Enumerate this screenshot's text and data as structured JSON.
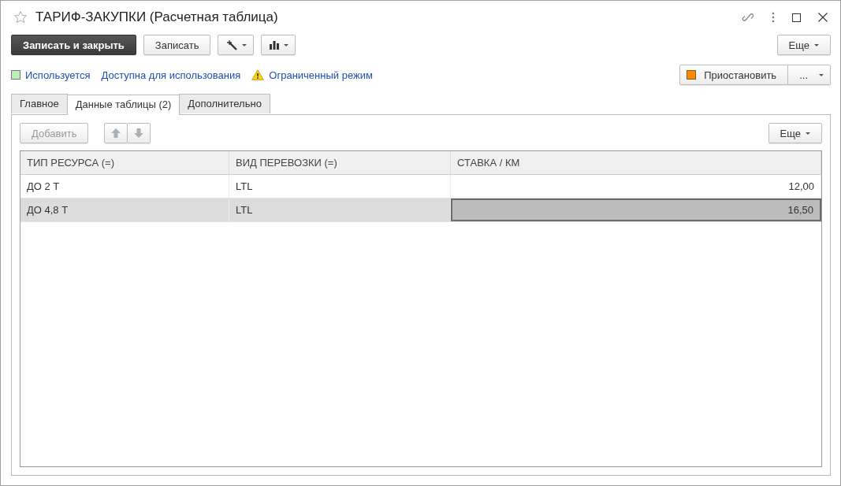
{
  "window": {
    "title": "ТАРИФ-ЗАКУПКИ (Расчетная таблица)",
    "favorite": false
  },
  "toolbar": {
    "buttons": [
      {
        "kind": "primary",
        "label": "Записать и закрыть"
      },
      {
        "kind": "normal",
        "label": "Записать"
      },
      {
        "kind": "wand-menu"
      },
      {
        "kind": "chart-menu"
      }
    ],
    "more": "Еще"
  },
  "status_links": [
    {
      "kind": "indicator",
      "label": "Используется"
    },
    {
      "kind": "plain",
      "label": "Доступна для использования"
    },
    {
      "kind": "warning",
      "label": "Ограниченный режим"
    }
  ],
  "suspend": {
    "label": "Приостановить",
    "more": "..."
  },
  "tabs": [
    {
      "label": "Главное",
      "selected": false
    },
    {
      "label": "Данные таблицы (2)",
      "selected": true
    },
    {
      "label": "Дополнительно",
      "selected": false
    }
  ],
  "table_toolbar": {
    "add": {
      "label": "Добавить",
      "disabled": true
    },
    "move_disabled": true,
    "more": "Еще"
  },
  "table": {
    "columns": [
      {
        "label": "ТИП РЕСУРСА (=)"
      },
      {
        "label": "ВИД ПЕРЕВОЗКИ (=)"
      },
      {
        "label": "СТАВКА / КМ"
      }
    ],
    "rows": [
      {
        "selected": false,
        "cells": [
          {
            "text": "ДО 2 Т",
            "focused": false
          },
          {
            "text": "LTL",
            "focused": false
          },
          {
            "text": "12,00",
            "focused": false
          }
        ]
      },
      {
        "selected": true,
        "cells": [
          {
            "text": "ДО 4,8 Т",
            "focused": false
          },
          {
            "text": "LTL",
            "focused": false
          },
          {
            "text": "16,50",
            "focused": true
          }
        ]
      }
    ]
  }
}
